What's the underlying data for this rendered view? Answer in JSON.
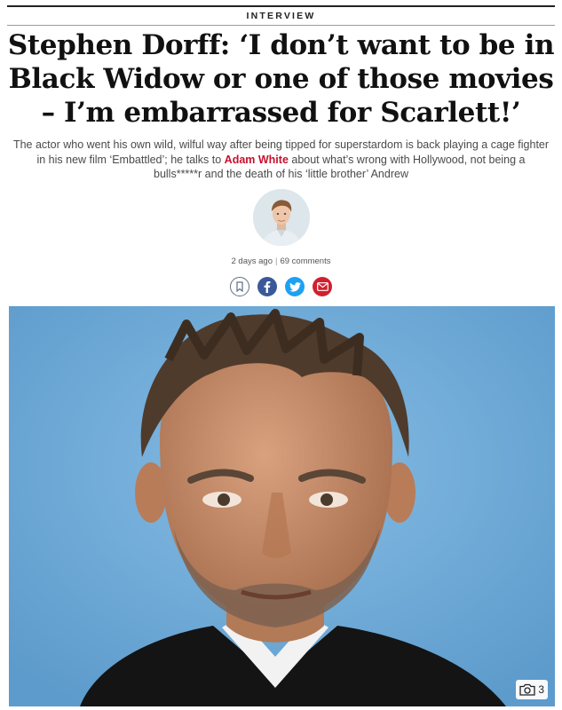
{
  "section": {
    "label": "INTERVIEW"
  },
  "headline": "Stephen Dorff: ‘I don’t want to be in Black Widow or one of those movies – I’m embarrassed for Scarlett!’",
  "standfirst": {
    "before": "The actor who went his own wild, wilful way after being tipped for superstardom is back playing a cage fighter in his new film ‘Embattled’; he talks to ",
    "author": "Adam White",
    "after": " about what’s wrong with Hollywood, not being a bulls*****r and the death of his ‘little brother’ Andrew"
  },
  "meta": {
    "date": "2 days ago",
    "separator": "|",
    "comments": "69 comments"
  },
  "share": {
    "icons": [
      "bookmark-icon",
      "facebook-icon",
      "twitter-icon",
      "email-icon"
    ],
    "colors": {
      "facebook": "#3b5998",
      "twitter": "#1da1f2",
      "email": "#d0202f",
      "bookmark": "#5f6f86"
    }
  },
  "hero": {
    "gallery_count": "3",
    "icon": "camera-icon"
  },
  "colors": {
    "accent": "#c8102e",
    "hero_background": "#6fa9d6"
  }
}
